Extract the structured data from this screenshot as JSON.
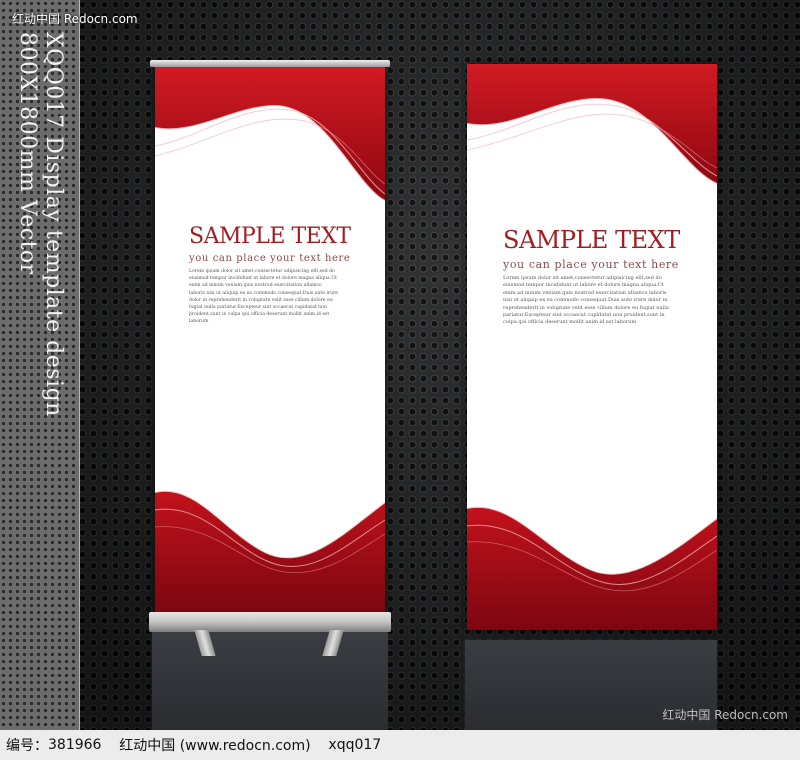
{
  "watermark": {
    "top": "红动中国 Redocn.com",
    "bottom": "红动中国 Redocn.com"
  },
  "side_title": {
    "line1": "XQQ017 Display template design",
    "line2": "800X1800mm Vector"
  },
  "banners": [
    {
      "title": "SAMPLE TEXT",
      "subtitle": "you can place your text here",
      "body": "Lorem ipsum dolor sit amet,consectetur adipisicing elit,sed do eiusmod tempor incididunt ut labore et dolore magna aliqua.Ut enim ad minim veniam,quis nostrud exercitation ullamco laboris nisi ut aliquip ex ea commodo consequat.Duis aute irure dolor in reprehenderit in voluptate velit esse cillum dolore eu fugiat nulla pariatur.Excepteur sint occaecat cupidatat non proident,sunt in culpa qui officia deserunt mollit anim id est laborum"
    },
    {
      "title": "SAMPLE TEXT",
      "subtitle": "you can place your text here",
      "body": "Lorem ipsum dolor sit amet,consectetur adipisicing elit,sed do eiusmod tempor incididunt ut labore et dolore magna aliqua.Ut enim ad minim veniam,quis nostrud exercitation ullamco laboris nisi ut aliquip ex ea commodo consequat.Duis aute irure dolor in reprehenderit in voluptate velit esse cillum dolore eu fugiat nulla pariatur.Excepteur sint occaecat cupidatat non proident,sunt in culpa qui officia deserunt mollit anim id est laborum"
    }
  ],
  "caption": {
    "id_label": "编号：",
    "id_value": "381966",
    "site": "红动中国 (www.redocn.com)",
    "author": "xqq017"
  },
  "colors": {
    "banner_red": "#c8101c",
    "title_red": "#a51b22",
    "background": "#242526"
  }
}
